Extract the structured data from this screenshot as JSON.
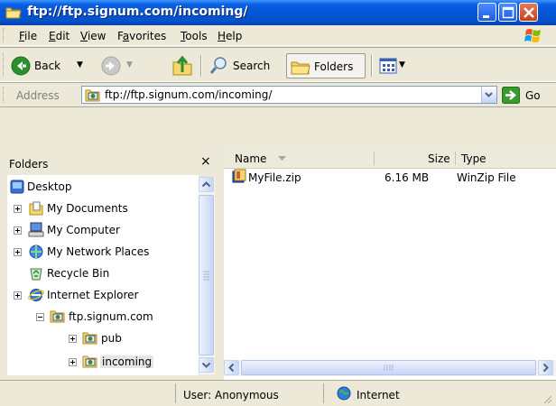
{
  "window": {
    "title": "ftp://ftp.signum.com/incoming/"
  },
  "menu": [
    "File",
    "Edit",
    "View",
    "Favorites",
    "Tools",
    "Help"
  ],
  "menu_underline_index": [
    0,
    0,
    0,
    1,
    0,
    0
  ],
  "toolbar": {
    "back_label": "Back",
    "search_label": "Search",
    "folders_label": "Folders"
  },
  "address": {
    "label": "Address",
    "value": "ftp://ftp.signum.com/incoming/",
    "go_label": "Go"
  },
  "folders": {
    "title": "Folders",
    "close_glyph": "×",
    "tree": [
      {
        "label": "Desktop",
        "icon": "desktop-icon",
        "expander": "none"
      },
      {
        "label": "My Documents",
        "icon": "my-documents-icon",
        "expander": "plus"
      },
      {
        "label": "My Computer",
        "icon": "my-computer-icon",
        "expander": "plus"
      },
      {
        "label": "My Network Places",
        "icon": "network-places-icon",
        "expander": "plus"
      },
      {
        "label": "Recycle Bin",
        "icon": "recycle-bin-icon",
        "expander": "none"
      },
      {
        "label": "Internet Explorer",
        "icon": "internet-explorer-icon",
        "expander": "plus"
      },
      {
        "label": "ftp.signum.com",
        "icon": "ftp-site-icon",
        "expander": "minus"
      },
      {
        "label": "pub",
        "icon": "ftp-folder-icon",
        "expander": "plus"
      },
      {
        "label": "incoming",
        "icon": "ftp-folder-icon",
        "expander": "plus",
        "selected": true
      }
    ]
  },
  "filelist": {
    "columns": [
      "Name",
      "Size",
      "Type"
    ],
    "rows": [
      {
        "name": "MyFile.zip",
        "size": "6.16 MB",
        "type": "WinZip File",
        "icon": "winzip-icon"
      }
    ]
  },
  "status": {
    "user": "User: Anonymous",
    "zone": "Internet"
  },
  "colors": {
    "titlebar": "#0455d8",
    "chrome": "#ece9d8",
    "close_button": "#c5401c"
  }
}
